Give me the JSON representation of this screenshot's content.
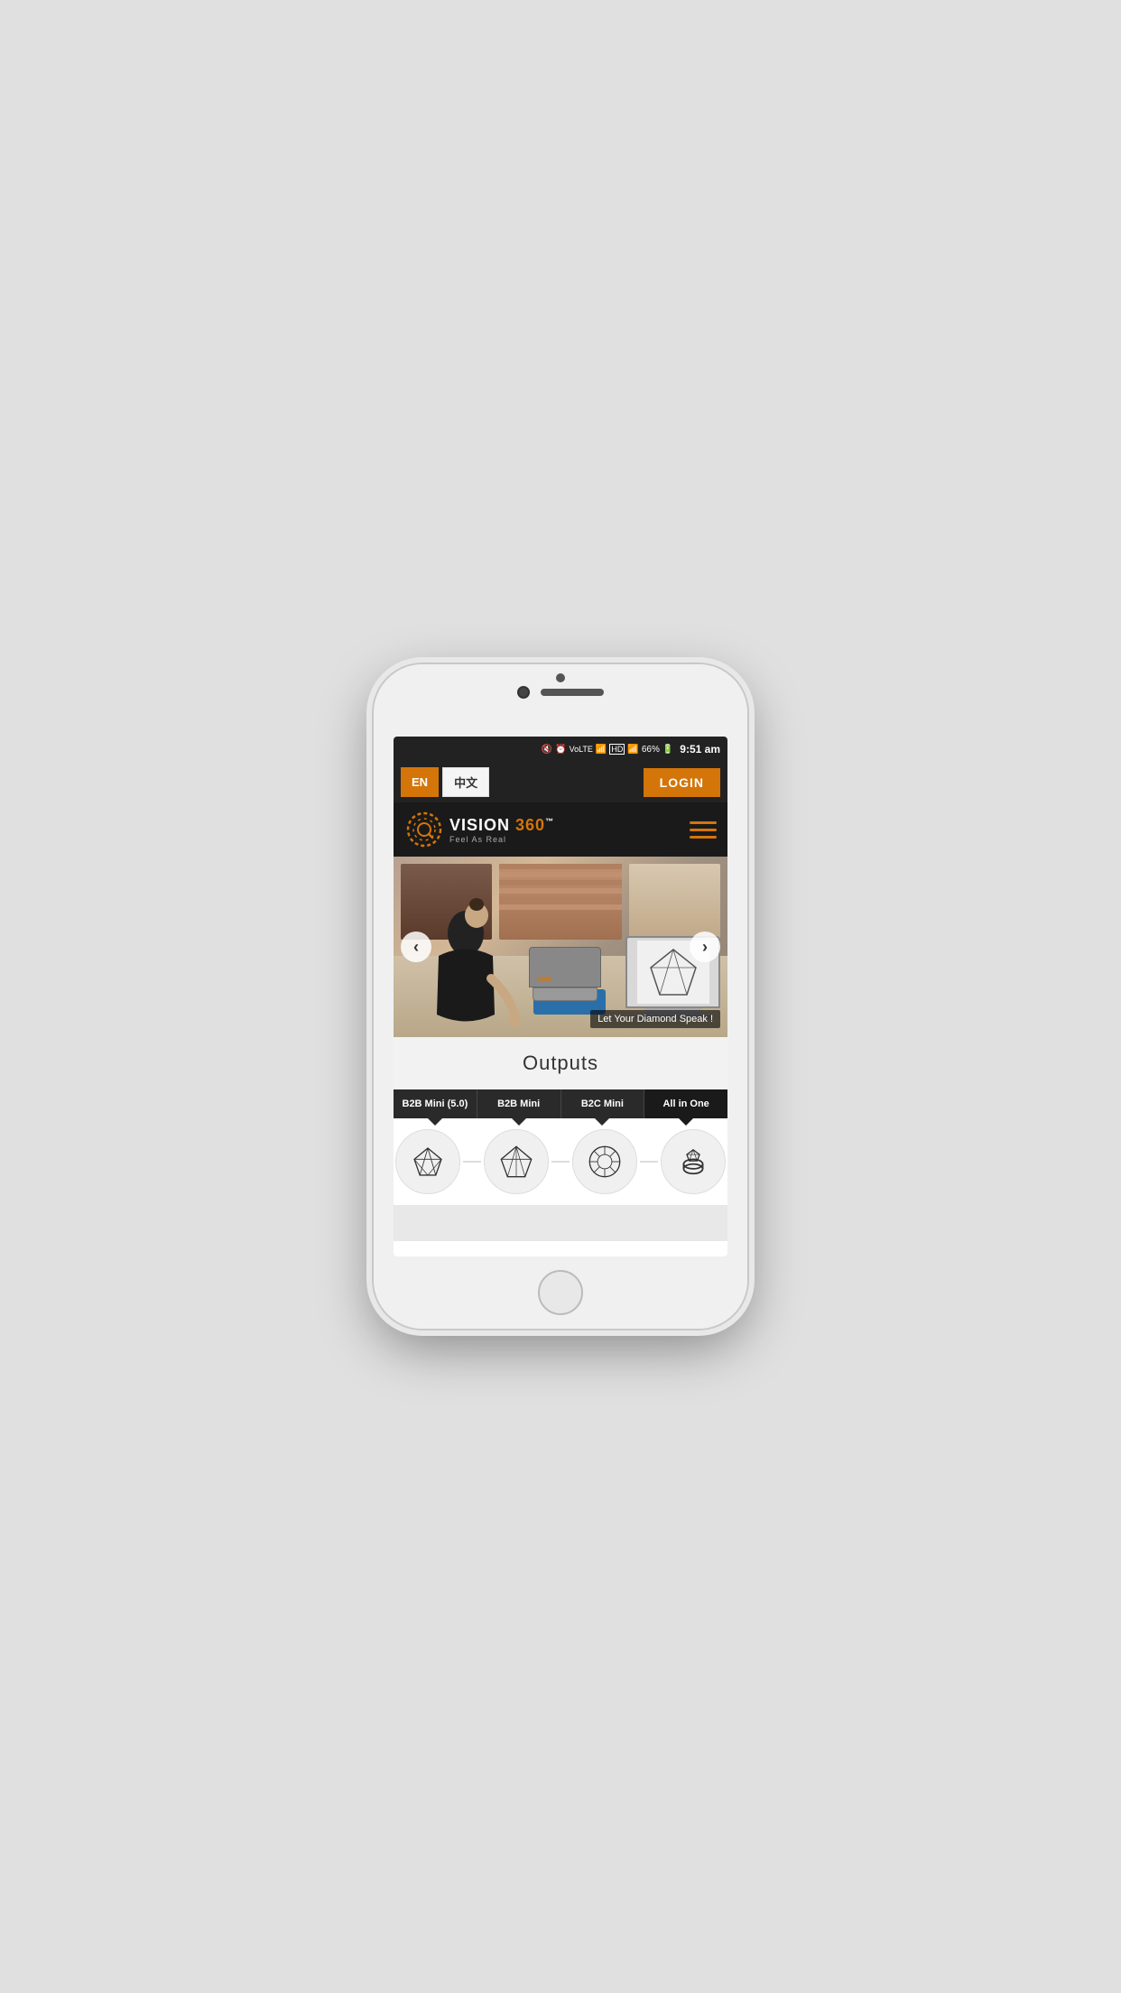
{
  "status_bar": {
    "mute_icon": "🔇",
    "alarm_icon": "⏰",
    "lte_label": "VoLTE",
    "wifi_icon": "WiFi",
    "hd_icon": "HD",
    "signal1": "▌▌▌",
    "signal2": "▌▌▌",
    "battery": "66%",
    "time": "9:51 am"
  },
  "header": {
    "lang_en": "EN",
    "lang_zh": "中文",
    "login_label": "LOGIN"
  },
  "nav": {
    "brand_name": "VISION 360",
    "brand_tm": "™",
    "tagline": "Feel As Real"
  },
  "hero": {
    "caption": "Let Your Diamond Speak !",
    "prev_label": "‹",
    "next_label": "›"
  },
  "outputs": {
    "section_title": "Outputs",
    "tabs": [
      {
        "id": "b2b-mini-50",
        "label": "B2B Mini (5.0)",
        "active": false
      },
      {
        "id": "b2b-mini",
        "label": "B2B Mini",
        "active": false
      },
      {
        "id": "b2c-mini",
        "label": "B2C Mini",
        "active": false
      },
      {
        "id": "all-in-one",
        "label": "All in One",
        "active": true
      }
    ],
    "icons": [
      {
        "id": "diamond-outline-1",
        "type": "diamond-side"
      },
      {
        "id": "diamond-outline-2",
        "type": "diamond-front"
      },
      {
        "id": "diamond-outline-3",
        "type": "diamond-top"
      },
      {
        "id": "ring-outline",
        "type": "ring"
      }
    ]
  },
  "colors": {
    "accent": "#d4750a",
    "dark_bg": "#1a1a1a",
    "tab_bg": "#2a2a2a"
  }
}
